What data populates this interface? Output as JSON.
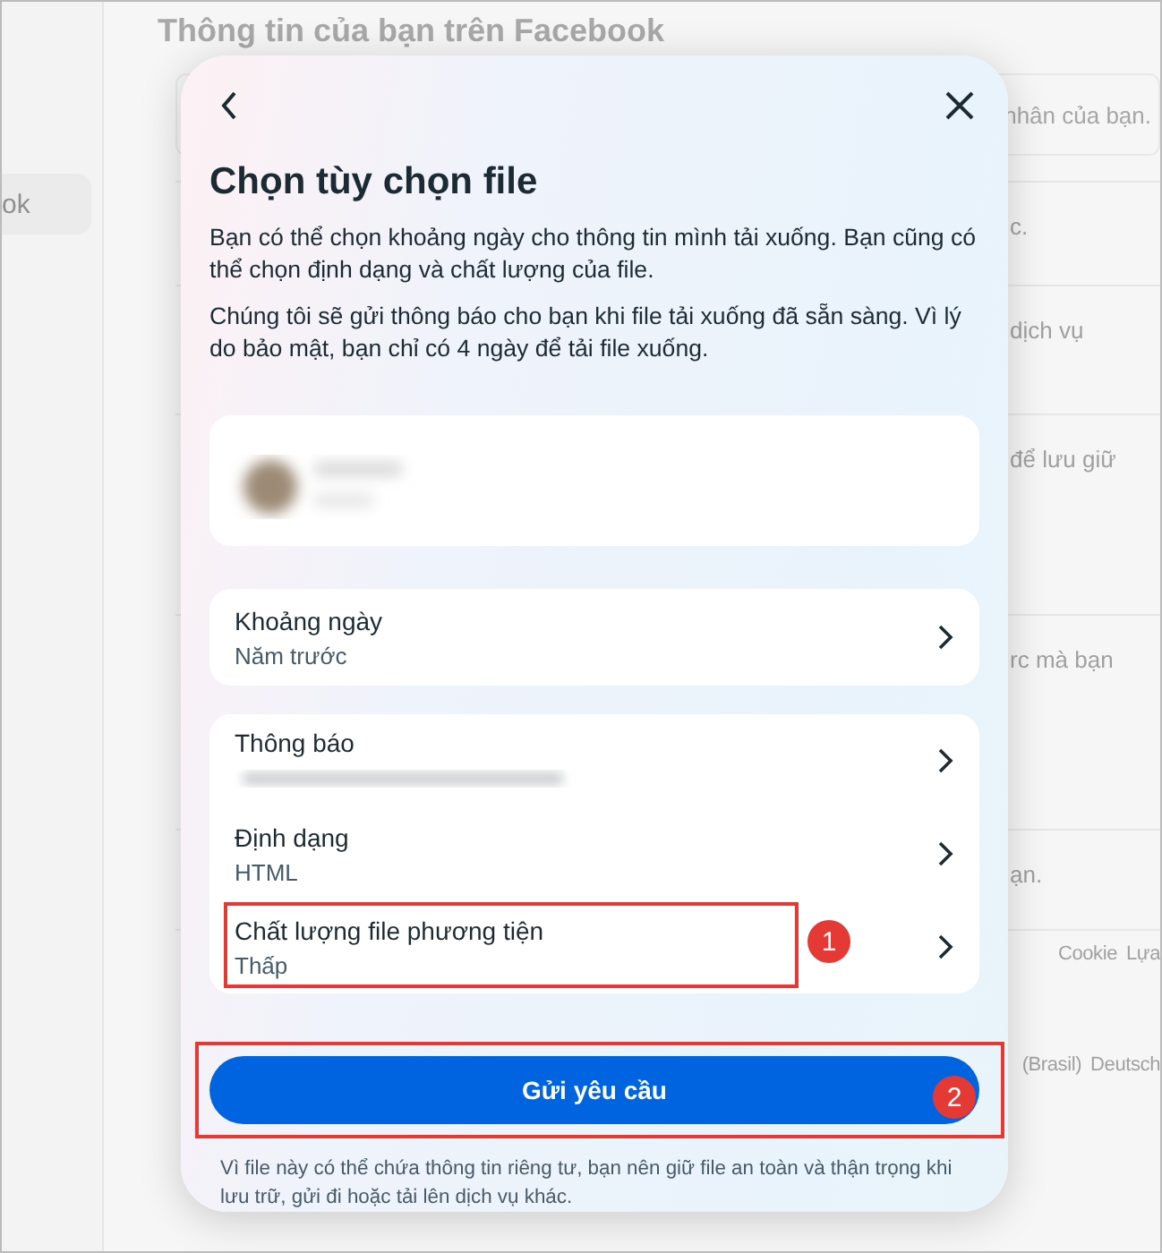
{
  "background_page": {
    "title": "Thông tin của bạn trên Facebook",
    "sidebar_item": "ok",
    "search_hint": "nhân của bạn.",
    "rows": [
      {
        "right": "c."
      },
      {
        "right": "dịch vụ"
      },
      {
        "right": "để lưu giữ"
      },
      {
        "right": "rc mà bạn"
      },
      {
        "right": "ạn."
      }
    ],
    "footer": [
      {
        "right": [
          "Cookie",
          "Lựa"
        ]
      },
      {
        "right": [
          "(Brasil)",
          "Deutsch"
        ]
      }
    ]
  },
  "dialog": {
    "title": "Chọn tùy chọn file",
    "paragraphs": [
      "Bạn có thể chọn khoảng ngày cho thông tin mình tải xuống. Bạn cũng có thể chọn định dạng và chất lượng của file.",
      "Chúng tôi sẽ gửi thông báo cho bạn khi file tải xuống đã sẵn sàng. Vì lý do bảo mật, bạn chỉ có 4 ngày để tải file xuống."
    ],
    "profile": {
      "kind": "picture"
    },
    "option_groups": [
      [
        {
          "label": "Khoảng ngày",
          "value": "Năm trước",
          "kind": "text"
        }
      ],
      [
        {
          "label": "Thông báo",
          "kind": "blurred"
        },
        {
          "label": "Định dạng",
          "value": "HTML",
          "kind": "text"
        },
        {
          "label": "Chất lượng file phương tiện",
          "value": "Thấp",
          "kind": "text",
          "annotation": "1"
        }
      ]
    ],
    "button": {
      "label": "Gửi yêu cầu",
      "annotation": "2"
    },
    "note": "Vì file này có thể chứa thông tin riêng tư, bạn nên giữ file an toàn và thận trọng khi lưu trữ, gửi đi hoặc tải lên dịch vụ khác."
  }
}
